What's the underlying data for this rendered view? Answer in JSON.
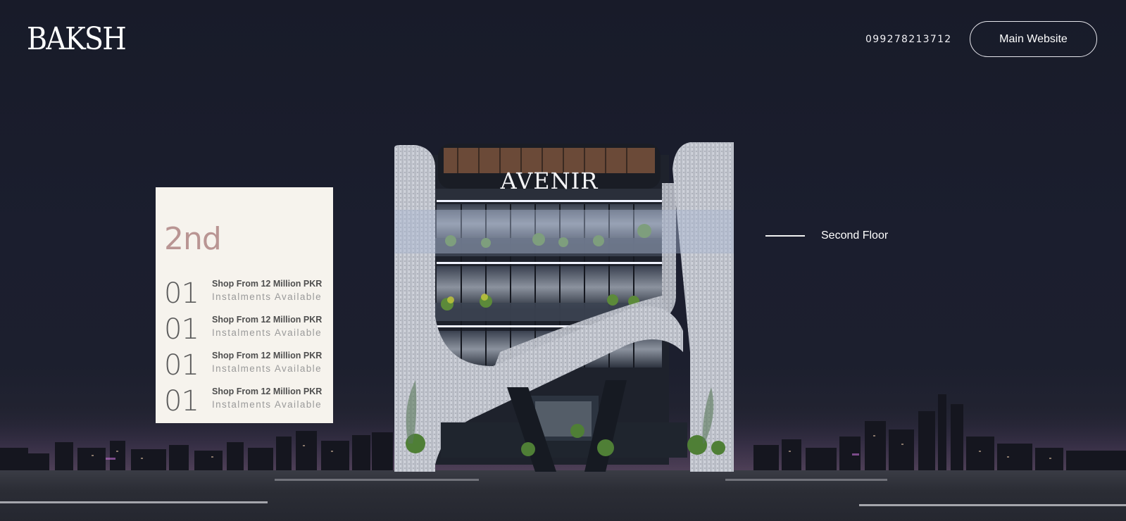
{
  "header": {
    "logo": "BAKSH",
    "phone": "099278213712",
    "main_website_label": "Main Website"
  },
  "building": {
    "sign": "AVENIR"
  },
  "card": {
    "floor": "2nd",
    "units": [
      {
        "number": "01",
        "title": "Shop From 12 Million PKR",
        "subtitle": "Instalments Available"
      },
      {
        "number": "01",
        "title": "Shop From 12 Million PKR",
        "subtitle": "Instalments Available"
      },
      {
        "number": "01",
        "title": "Shop From 12 Million PKR",
        "subtitle": "Instalments Available"
      },
      {
        "number": "01",
        "title": "Shop From 12 Million PKR",
        "subtitle": "Instalments Available"
      }
    ]
  },
  "floor_indicator": {
    "label": "Second Floor"
  },
  "colors": {
    "background": "#1b1e2e",
    "card_bg": "#f6f3ed",
    "floor_accent": "#b99593",
    "highlight": "#a9b6d1"
  }
}
